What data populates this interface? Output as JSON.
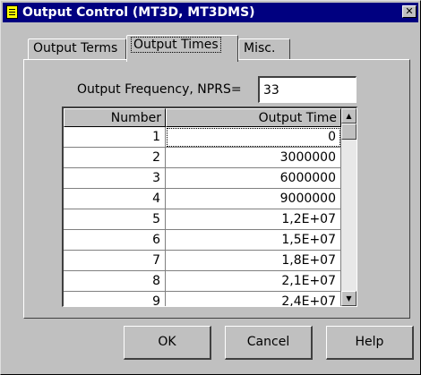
{
  "window": {
    "title": "Output Control (MT3D, MT3DMS)",
    "close_glyph": "✕"
  },
  "tabs": [
    {
      "label": "Output Terms"
    },
    {
      "label": "Output Times"
    },
    {
      "label": "Misc."
    }
  ],
  "frequency": {
    "label": "Output Frequency, NPRS=",
    "value": "33"
  },
  "grid": {
    "columns": [
      "Number",
      "Output Time"
    ],
    "rows": [
      {
        "number": "1",
        "time": "0"
      },
      {
        "number": "2",
        "time": "3000000"
      },
      {
        "number": "3",
        "time": "6000000"
      },
      {
        "number": "4",
        "time": "9000000"
      },
      {
        "number": "5",
        "time": "1,2E+07"
      },
      {
        "number": "6",
        "time": "1,5E+07"
      },
      {
        "number": "7",
        "time": "1,8E+07"
      },
      {
        "number": "8",
        "time": "2,1E+07"
      },
      {
        "number": "9",
        "time": "2,4E+07"
      }
    ],
    "scroll_up_glyph": "▲",
    "scroll_down_glyph": "▼"
  },
  "buttons": {
    "ok": "OK",
    "cancel": "Cancel",
    "help": "Help"
  }
}
